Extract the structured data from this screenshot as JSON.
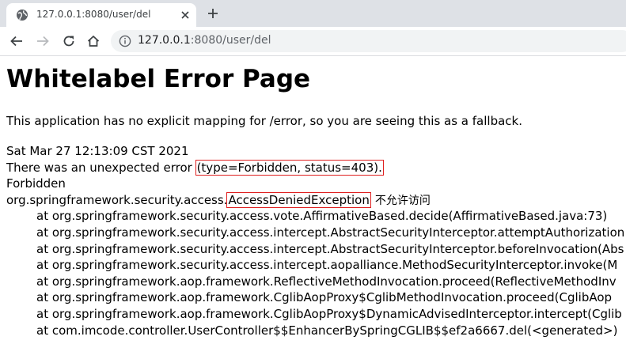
{
  "browser": {
    "tab_title": "127.0.0.1:8080/user/del",
    "url_host": "127.0.0.1",
    "url_rest": ":8080/user/del"
  },
  "page": {
    "heading": "Whitelabel Error Page",
    "explanation": "This application has no explicit mapping for /error, so you are seeing this as a fallback.",
    "timestamp": "Sat Mar 27 12:13:09 CST 2021",
    "error_prefix": "There was an unexpected error ",
    "error_detail": "(type=Forbidden, status=403).",
    "status_text": "Forbidden",
    "exception_package": "org.springframework.security.access.",
    "exception_class": "AccessDeniedException",
    "exception_message": "不允许访问",
    "stack_trace": [
      "at org.springframework.security.access.vote.AffirmativeBased.decide(AffirmativeBased.java:73)",
      "at org.springframework.security.access.intercept.AbstractSecurityInterceptor.attemptAuthorization",
      "at org.springframework.security.access.intercept.AbstractSecurityInterceptor.beforeInvocation(Abs",
      "at org.springframework.security.access.intercept.aopalliance.MethodSecurityInterceptor.invoke(M",
      "at org.springframework.aop.framework.ReflectiveMethodInvocation.proceed(ReflectiveMethodInv",
      "at org.springframework.aop.framework.CglibAopProxy$CglibMethodInvocation.proceed(CglibAop",
      "at org.springframework.aop.framework.CglibAopProxy$DynamicAdvisedInterceptor.intercept(Cglib",
      "at com.imcode.controller.UserController$$EnhancerBySpringCGLIB$$ef2a6667.del(<generated>)"
    ]
  },
  "colors": {
    "highlight_box": "#e02020",
    "tabstrip": "#dee1e6",
    "omnibox": "#f1f3f4"
  }
}
